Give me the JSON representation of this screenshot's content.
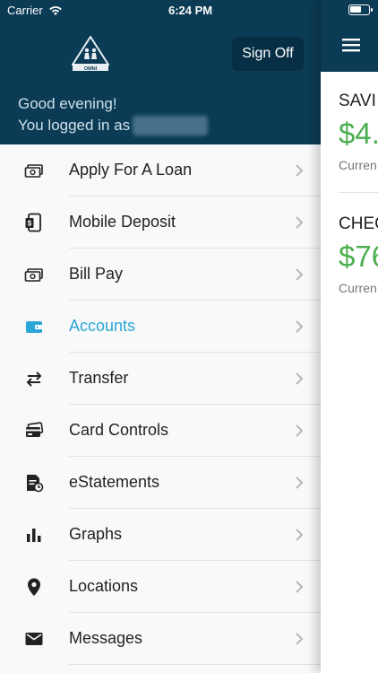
{
  "status_bar": {
    "carrier": "Carrier",
    "time": "6:24 PM"
  },
  "header": {
    "logo_text": "OMNI",
    "sign_off_label": "Sign Off",
    "greeting_line1": "Good evening!",
    "greeting_line2": "You logged in as"
  },
  "menu": {
    "items": [
      {
        "label": "Apply For A Loan",
        "icon": "cash-icon"
      },
      {
        "label": "Mobile Deposit",
        "icon": "mobile-deposit-icon"
      },
      {
        "label": "Bill Pay",
        "icon": "cash-icon"
      },
      {
        "label": "Accounts",
        "icon": "wallet-icon",
        "active": true
      },
      {
        "label": "Transfer",
        "icon": "transfer-arrows-icon"
      },
      {
        "label": "Card Controls",
        "icon": "credit-card-icon"
      },
      {
        "label": "eStatements",
        "icon": "statement-icon"
      },
      {
        "label": "Graphs",
        "icon": "bar-chart-icon"
      },
      {
        "label": "Locations",
        "icon": "location-pin-icon"
      },
      {
        "label": "Messages",
        "icon": "mail-icon"
      }
    ]
  },
  "colors": {
    "header": "#0b3b55",
    "accent": "#2aa6d9",
    "balance": "#4caf50"
  },
  "main": {
    "accounts": [
      {
        "name": "SAVI",
        "balance": "$4.",
        "sub": "Curren"
      },
      {
        "name": "CHEC",
        "balance": "$76",
        "sub": "Curren"
      }
    ]
  }
}
